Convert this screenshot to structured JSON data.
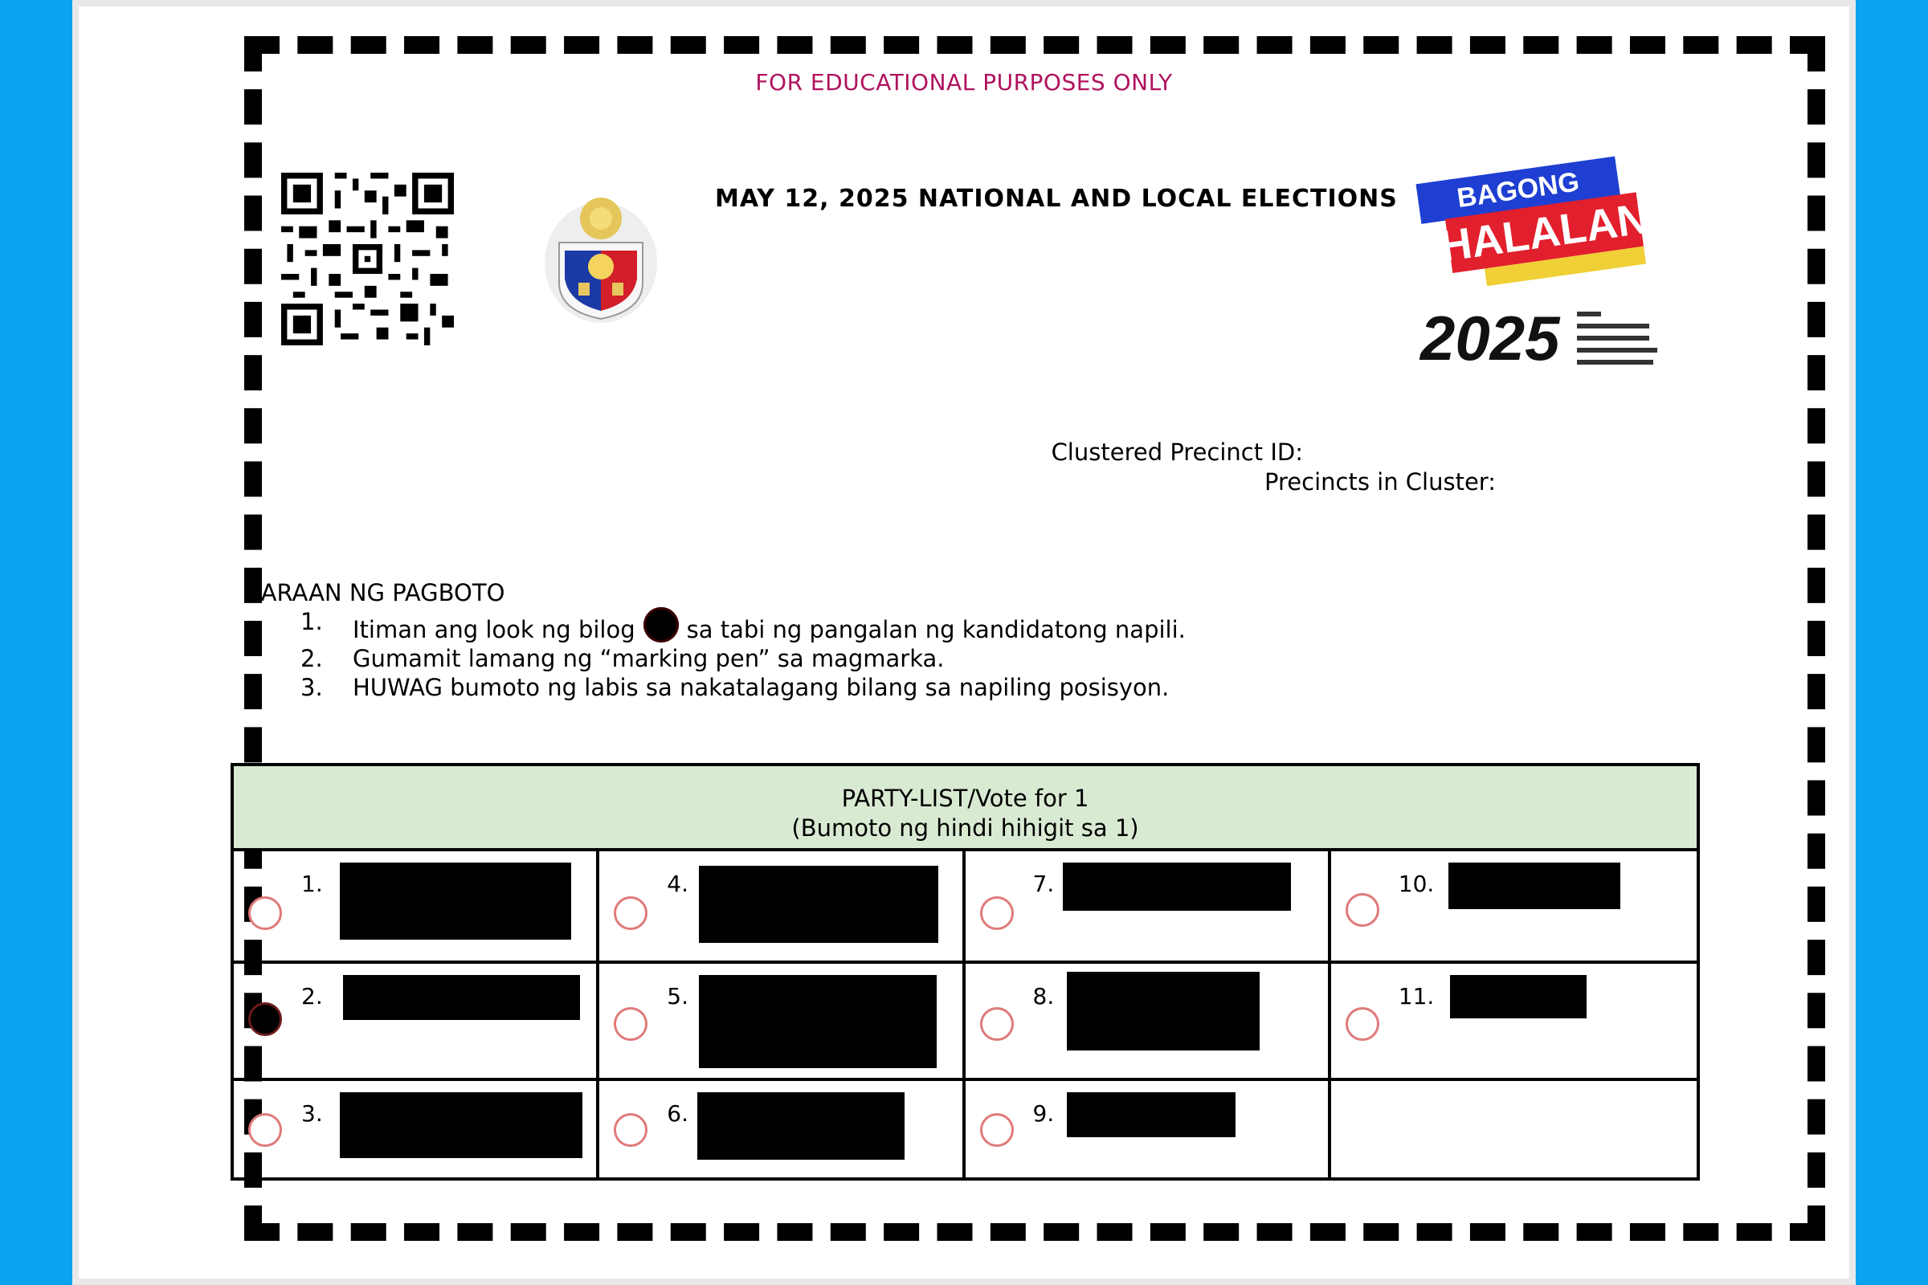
{
  "header": {
    "watermark": "FOR EDUCATIONAL PURPOSES ONLY",
    "title": "MAY 12, 2025 NATIONAL AND LOCAL ELECTIONS",
    "logo_text": "BAGONG HALALAN 2025"
  },
  "precinct": {
    "clustered_label": "Clustered Precinct ID:",
    "cluster_label": "Precincts in Cluster:"
  },
  "instructions": {
    "heading": "PARAAN NG PAGBOTO",
    "items": [
      {
        "num": "1.",
        "before": "Itiman ang look ng bilog",
        "after": "sa tabi ng pangalan ng kandidatong napili."
      },
      {
        "num": "2.",
        "text": "Gumamit lamang ng “marking pen” sa magmarka."
      },
      {
        "num": "3.",
        "text": "HUWAG bumoto ng labis sa nakatalagang bilang sa napiling posisyon."
      }
    ]
  },
  "ballot": {
    "title": "PARTY-LIST/Vote for 1",
    "subtitle": "(Bumoto ng hindi hihigit sa 1)",
    "candidates": [
      {
        "num": "1.",
        "selected": false
      },
      {
        "num": "2.",
        "selected": true
      },
      {
        "num": "3.",
        "selected": false
      },
      {
        "num": "4.",
        "selected": false
      },
      {
        "num": "5.",
        "selected": false
      },
      {
        "num": "6.",
        "selected": false
      },
      {
        "num": "7.",
        "selected": false
      },
      {
        "num": "8.",
        "selected": false
      },
      {
        "num": "9.",
        "selected": false
      },
      {
        "num": "10.",
        "selected": false
      },
      {
        "num": "11.",
        "selected": false
      }
    ]
  },
  "colors": {
    "background": "#0aa3f0",
    "watermark": "#b0125e",
    "header_fill": "#d9ead3",
    "oval_border": "#e07a7a"
  }
}
